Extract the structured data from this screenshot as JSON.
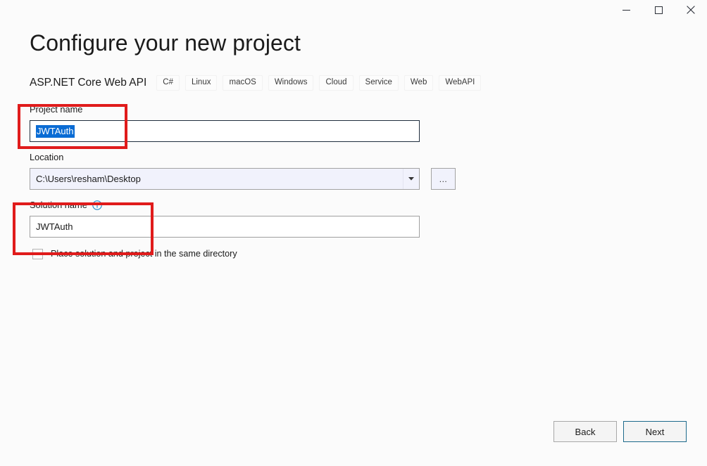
{
  "window": {
    "controls": [
      {
        "name": "minimize",
        "glyph": "minimize-icon"
      },
      {
        "name": "maximize",
        "glyph": "maximize-icon"
      },
      {
        "name": "close",
        "glyph": "close-icon"
      }
    ]
  },
  "header": {
    "title": "Configure your new project",
    "template_name": "ASP.NET Core Web API",
    "tags": [
      "C#",
      "Linux",
      "macOS",
      "Windows",
      "Cloud",
      "Service",
      "Web",
      "WebAPI"
    ]
  },
  "form": {
    "project_name": {
      "label": "Project name",
      "value": "JWTAuth",
      "selected": true
    },
    "location": {
      "label": "Location",
      "value": "C:\\Users\\resham\\Desktop",
      "browse_label": "..."
    },
    "solution_name": {
      "label": "Solution name",
      "info_icon": "info-icon",
      "value": "JWTAuth"
    },
    "same_directory": {
      "label": "Place solution and project in the same directory",
      "checked": false
    }
  },
  "footer": {
    "back_label": "Back",
    "next_label": "Next"
  },
  "colors": {
    "accent": "#0a6cd4",
    "annotation": "#e01b1b",
    "next_border": "#1d6a8c",
    "page_background": "#fbfbfb",
    "combo_background": "#f1f2fc"
  }
}
